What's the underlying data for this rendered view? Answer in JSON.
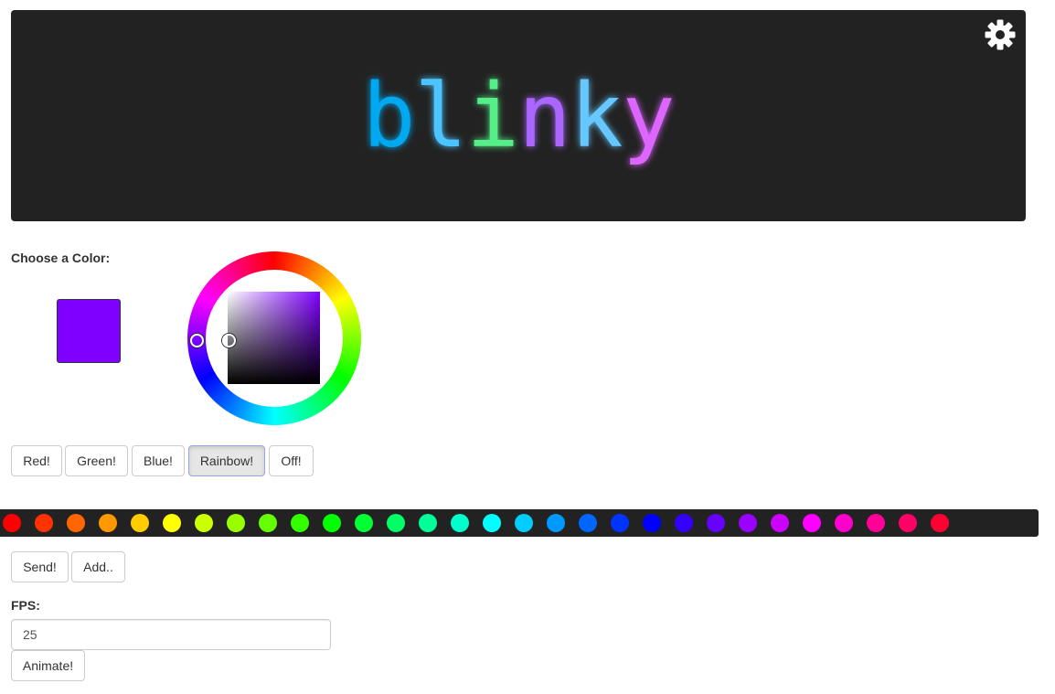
{
  "header": {
    "logo_letters": [
      {
        "char": "b",
        "color": "#00a8f0"
      },
      {
        "char": "l",
        "color": "#4cc4ff"
      },
      {
        "char": "i",
        "color": "#55ee88"
      },
      {
        "char": "n",
        "color": "#aa66ff"
      },
      {
        "char": "k",
        "color": "#66c8ff"
      },
      {
        "char": "y",
        "color": "#dd66ff"
      }
    ],
    "settings_icon": "gear-icon"
  },
  "color_picker": {
    "label": "Choose a Color:",
    "selected_color": "#7f00ff",
    "hue_color": "#7f00ff"
  },
  "preset_buttons": [
    {
      "label": "Red!",
      "active": false
    },
    {
      "label": "Green!",
      "active": false
    },
    {
      "label": "Blue!",
      "active": false
    },
    {
      "label": "Rainbow!",
      "active": true
    },
    {
      "label": "Off!",
      "active": false
    }
  ],
  "led_strip": {
    "colors": [
      "#ff0000",
      "#ff3300",
      "#ff6600",
      "#ff9900",
      "#ffcc00",
      "#ffff00",
      "#ccff00",
      "#99ff00",
      "#66ff00",
      "#33ff00",
      "#00ff00",
      "#00ff33",
      "#00ff66",
      "#00ff99",
      "#00ffcc",
      "#00ffff",
      "#00ccff",
      "#0099ff",
      "#0066ff",
      "#0033ff",
      "#0000ff",
      "#3300ff",
      "#6600ff",
      "#9900ff",
      "#cc00ff",
      "#ff00ff",
      "#ff00cc",
      "#ff0099",
      "#ff0066",
      "#ff0033"
    ]
  },
  "actions": {
    "send_label": "Send!",
    "add_label": "Add.."
  },
  "fps": {
    "label": "FPS:",
    "value": "25"
  },
  "animate": {
    "label": "Animate!"
  }
}
